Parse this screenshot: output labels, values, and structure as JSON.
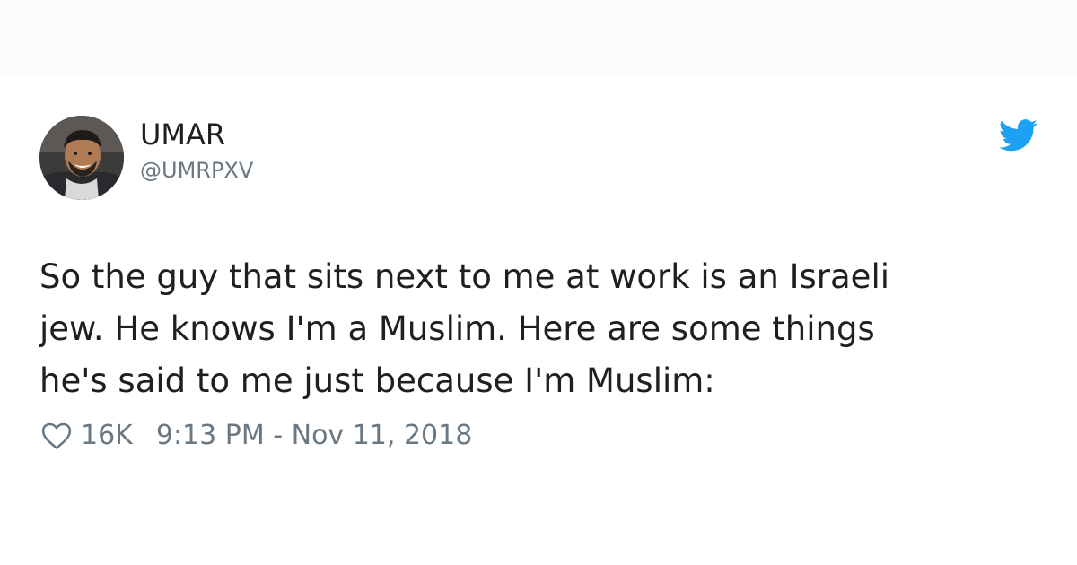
{
  "tweet": {
    "author": {
      "display_name": "UMAR",
      "handle": "@UMRPXV"
    },
    "text_lines": [
      "So the guy that sits next to me at work is an Israeli",
      "jew. He knows I'm a Muslim. Here are some things",
      "he's said to me just because I'm Muslim:"
    ],
    "likes": "16K",
    "timestamp": "9:13 PM - Nov 11, 2018"
  },
  "icons": {
    "brand": "twitter-bird-icon",
    "like": "heart-icon"
  },
  "colors": {
    "brand_blue": "#1da1f2",
    "text_primary": "#1c2022",
    "text_secondary": "#697882",
    "background": "#ffffff"
  }
}
